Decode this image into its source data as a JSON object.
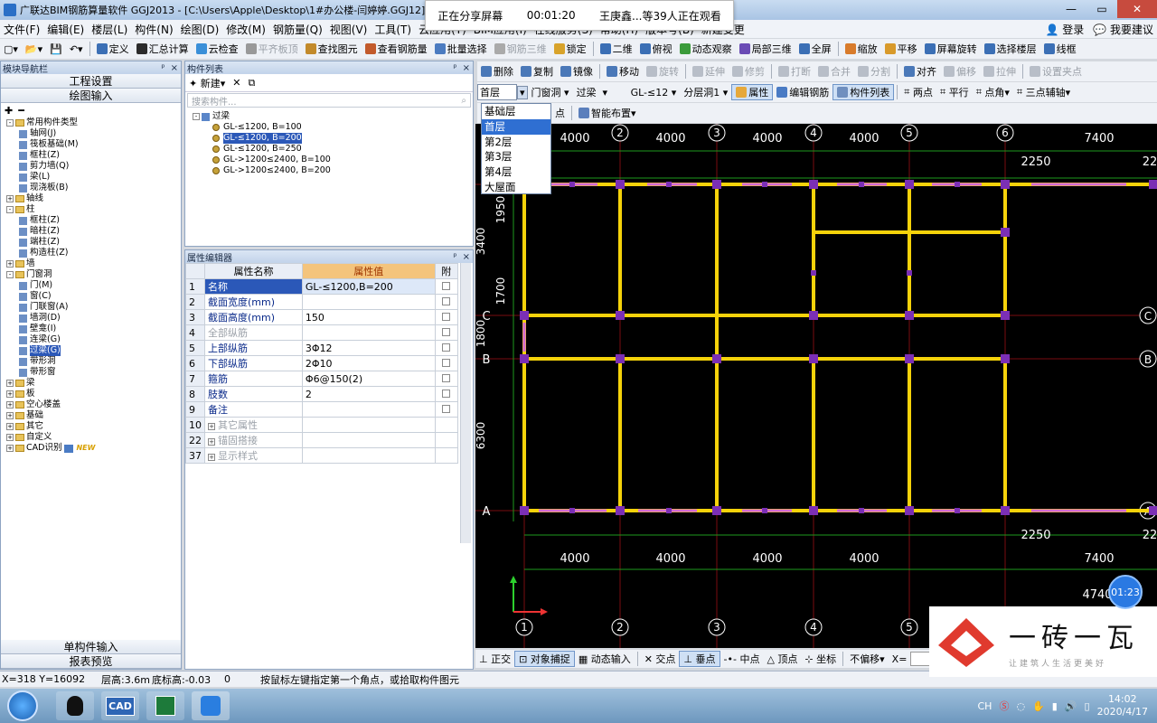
{
  "window": {
    "title": "广联达BIM钢筋算量软件 GGJ2013 - [C:\\Users\\Apple\\Desktop\\1#办公楼-闫婷婷.GGJ12]"
  },
  "share": {
    "status": "正在分享屏幕",
    "time": "00:01:20",
    "viewers": "王庚鑫...等39人正在观看"
  },
  "menu": [
    "文件(F)",
    "编辑(E)",
    "楼层(L)",
    "构件(N)",
    "绘图(D)",
    "修改(M)",
    "钢筋量(Q)",
    "视图(V)",
    "工具(T)",
    "云应用(Y)",
    "BIM应用(I)",
    "在线服务(S)",
    "帮助(H)",
    "版本号(B)",
    "新建变更"
  ],
  "menu_right": {
    "login": "登录",
    "suggest": "我要建议"
  },
  "toolbar1": [
    "定义",
    "汇总计算",
    "云检查",
    "平齐板顶",
    "查找图元",
    "查看钢筋量",
    "批量选择",
    "钢筋三维",
    "锁定",
    "二维",
    "俯视",
    "动态观察",
    "局部三维",
    "全屏",
    "缩放",
    "平移",
    "屏幕旋转",
    "选择楼层",
    "线框"
  ],
  "toolbar2": [
    "删除",
    "复制",
    "镜像",
    "移动",
    "旋转",
    "延伸",
    "修剪",
    "打断",
    "合并",
    "分割",
    "对齐",
    "偏移",
    "拉伸",
    "设置夹点"
  ],
  "toolbar3": {
    "floor": "首层",
    "category": "门窗洞",
    "type": "过梁",
    "component": "GL-≤12",
    "layer": "分层洞1",
    "attr": "属性",
    "edit_rebar": "编辑钢筋",
    "component_list": "构件列表",
    "two_point": "两点",
    "parallel": "平行",
    "point_angle": "点角",
    "three_point_axis": "三点辅轴"
  },
  "toolbar4": {
    "point": "点",
    "smart": "智能布置"
  },
  "floor_options": [
    "基础层",
    "首层",
    "第2层",
    "第3层",
    "第4层",
    "大屋面"
  ],
  "nav": {
    "title": "模块导航栏",
    "project_settings": "工程设置",
    "drawing_input": "绘图输入",
    "single_input": "单构件输入",
    "report_preview": "报表预览",
    "tree": [
      {
        "label": "常用构件类型",
        "level": 0,
        "folder": true,
        "exp": "-"
      },
      {
        "label": "轴网(J)",
        "level": 1
      },
      {
        "label": "筏板基础(M)",
        "level": 1
      },
      {
        "label": "框柱(Z)",
        "level": 1
      },
      {
        "label": "剪力墙(Q)",
        "level": 1
      },
      {
        "label": "梁(L)",
        "level": 1
      },
      {
        "label": "现浇板(B)",
        "level": 1
      },
      {
        "label": "轴线",
        "level": 0,
        "folder": true,
        "exp": "+"
      },
      {
        "label": "柱",
        "level": 0,
        "folder": true,
        "exp": "-"
      },
      {
        "label": "框柱(Z)",
        "level": 1
      },
      {
        "label": "暗柱(Z)",
        "level": 1
      },
      {
        "label": "端柱(Z)",
        "level": 1
      },
      {
        "label": "构造柱(Z)",
        "level": 1
      },
      {
        "label": "墙",
        "level": 0,
        "folder": true,
        "exp": "+"
      },
      {
        "label": "门窗洞",
        "level": 0,
        "folder": true,
        "exp": "-"
      },
      {
        "label": "门(M)",
        "level": 1
      },
      {
        "label": "窗(C)",
        "level": 1
      },
      {
        "label": "门联窗(A)",
        "level": 1
      },
      {
        "label": "墙洞(D)",
        "level": 1
      },
      {
        "label": "壁龛(I)",
        "level": 1
      },
      {
        "label": "连梁(G)",
        "level": 1
      },
      {
        "label": "过梁(G)",
        "level": 1,
        "selected": true
      },
      {
        "label": "带形洞",
        "level": 1
      },
      {
        "label": "带形窗",
        "level": 1
      },
      {
        "label": "梁",
        "level": 0,
        "folder": true,
        "exp": "+"
      },
      {
        "label": "板",
        "level": 0,
        "folder": true,
        "exp": "+"
      },
      {
        "label": "空心楼盖",
        "level": 0,
        "folder": true,
        "exp": "+"
      },
      {
        "label": "基础",
        "level": 0,
        "folder": true,
        "exp": "+"
      },
      {
        "label": "其它",
        "level": 0,
        "folder": true,
        "exp": "+"
      },
      {
        "label": "自定义",
        "level": 0,
        "folder": true,
        "exp": "+"
      },
      {
        "label": "CAD识别",
        "level": 0,
        "folder": true,
        "exp": "+",
        "badge": "NEW"
      }
    ]
  },
  "component_list": {
    "title": "构件列表",
    "new_label": "新建",
    "search_placeholder": "搜索构件...",
    "root": "过梁",
    "items": [
      "GL-≤1200, B=100",
      "GL-≤1200, B=200",
      "GL-≤1200, B=250",
      "GL->1200≤2400, B=100",
      "GL->1200≤2400, B=200"
    ],
    "selected_index": 1
  },
  "prop_editor": {
    "title": "属性编辑器",
    "headers": [
      "属性名称",
      "属性值",
      "附"
    ],
    "rows": [
      {
        "no": "1",
        "name": "名称",
        "value": "GL-≤1200,B=200",
        "style": "sel"
      },
      {
        "no": "2",
        "name": "截面宽度(mm)",
        "value": ""
      },
      {
        "no": "3",
        "name": "截面高度(mm)",
        "value": "150"
      },
      {
        "no": "4",
        "name": "全部纵筋",
        "value": "",
        "gray": true
      },
      {
        "no": "5",
        "name": "上部纵筋",
        "value": "3Φ12"
      },
      {
        "no": "6",
        "name": "下部纵筋",
        "value": "2Φ10"
      },
      {
        "no": "7",
        "name": "箍筋",
        "value": "Φ6@150(2)"
      },
      {
        "no": "8",
        "name": "肢数",
        "value": "2"
      },
      {
        "no": "9",
        "name": "备注",
        "value": ""
      },
      {
        "no": "10",
        "name": "其它属性",
        "value": "",
        "gray": true,
        "group": true
      },
      {
        "no": "22",
        "name": "锚固搭接",
        "value": "",
        "gray": true,
        "group": true
      },
      {
        "no": "37",
        "name": "显示样式",
        "value": "",
        "gray": true,
        "group": true
      }
    ]
  },
  "canvas": {
    "top_dims": [
      "4000",
      "4000",
      "4000",
      "4000",
      "7400"
    ],
    "top_sub_dims": [
      "2250",
      "22"
    ],
    "bottom_dims": [
      "4000",
      "4000",
      "4000",
      "4000",
      "7400"
    ],
    "bottom_sub_dims": [
      "2250",
      "22"
    ],
    "left_dims": [
      "1950",
      "1700",
      "1800",
      "6300",
      "3400"
    ],
    "axis_top": [
      "2",
      "3",
      "4",
      "5",
      "6"
    ],
    "axis_bottom": [
      "1",
      "2",
      "3",
      "4",
      "5"
    ],
    "axis_left": [
      "C",
      "B",
      "A"
    ],
    "axis_right": [
      "C",
      "B",
      "A"
    ],
    "corner_dim": "4740"
  },
  "snap": {
    "ortho": "正交",
    "object_snap": "对象捕捉",
    "dynamic_input": "动态输入",
    "intersection": "交点",
    "perpendicular": "垂点",
    "midpoint": "中点",
    "vertex": "顶点",
    "coord": "坐标",
    "no_offset": "不偏移",
    "x_label": "X="
  },
  "status": {
    "coords": "X=318  Y=16092",
    "floor_height": "层高:3.6m",
    "bottom_elev": "底标高:-0.03",
    "zero": "0",
    "hint": "按鼠标左键指定第一个角点，或拾取构件图元"
  },
  "timer": "01:23",
  "logo": {
    "name": "一砖一瓦",
    "slogan": "让建筑人生活更美好"
  },
  "taskbar": {
    "ime": "CH",
    "time": "14:02",
    "date": "2020/4/17",
    "cad": "CAD"
  },
  "colors": {
    "wall": "#f5d20a",
    "column": "#7b2fb5",
    "grid": "#7a0b10",
    "axis_green": "#1e9a1e",
    "window": "#d36ad6"
  }
}
